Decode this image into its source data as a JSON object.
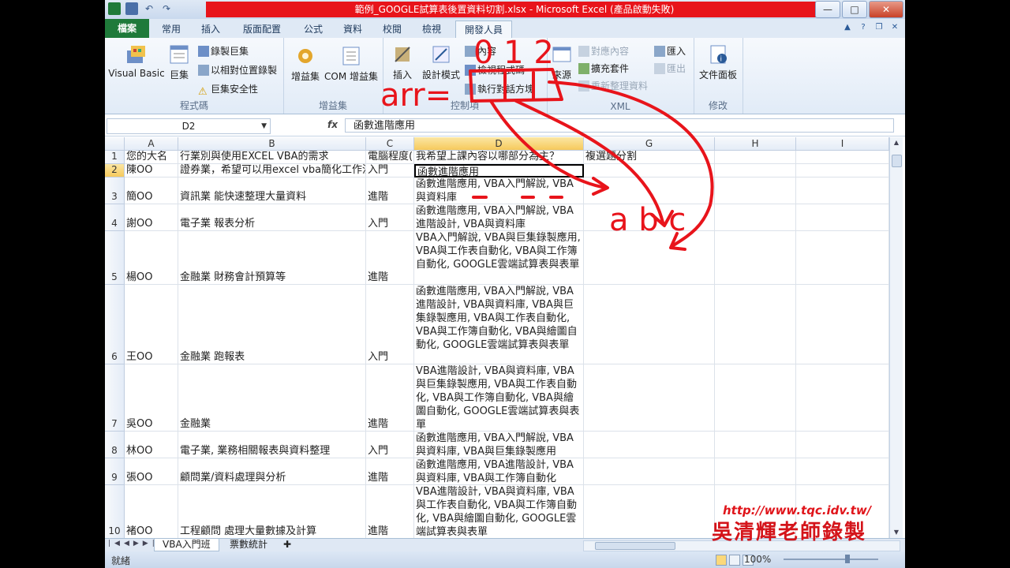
{
  "window": {
    "title": "範例_GOOGLE試算表後置資料切割.xlsx  -  Microsoft Excel (產品啟動失敗)",
    "controls": [
      "—",
      "□",
      "✕"
    ]
  },
  "tabs": [
    "檔案",
    "常用",
    "插入",
    "版面配置",
    "公式",
    "資料",
    "校閱",
    "檢視",
    "開發人員"
  ],
  "ribbon": {
    "code": {
      "label": "程式碼",
      "visual_basic": "Visual Basic",
      "macros": "巨集",
      "record_macro": "錄製巨集",
      "relative_ref": "以相對位置錄製",
      "macro_security": "巨集安全性"
    },
    "addins": {
      "label": "增益集",
      "addins": "增益集",
      "com_addins": "COM 增益集"
    },
    "controls": {
      "label": "控制項",
      "insert": "插入",
      "design_mode": "設計模式",
      "properties": "內容",
      "view_code": "檢視程式碼",
      "run_dialog": "執行對話方塊"
    },
    "xml": {
      "label": "XML",
      "source": "來源",
      "map_properties": "對應內容",
      "expansion_packs": "擴充套件",
      "refresh_data": "重新整理資料",
      "import": "匯入",
      "export": "匯出"
    },
    "modify": {
      "label": "修改",
      "document_panel": "文件面板"
    }
  },
  "formula_bar": {
    "name_box": "D2",
    "fx": "fx",
    "content": "函數進階應用"
  },
  "columns": [
    "A",
    "B",
    "C",
    "D",
    "G",
    "H",
    "I"
  ],
  "rows": [
    {
      "n": "1",
      "a": "您的大名",
      "b": "行業別與使用EXCEL VBA的需求",
      "c": "電腦程度(",
      "d": "我希望上課內容以哪部分為主？",
      "g": "複選題分割"
    },
    {
      "n": "2",
      "a": "陳OO",
      "b": "證券業，希望可以用excel vba簡化工作流程",
      "c": "入門",
      "d": "函數進階應用",
      "g": ""
    },
    {
      "n": "3",
      "a": "簡OO",
      "b": "資訊業  能快速整理大量資料",
      "c": "進階",
      "d": "函數進階應用, VBA入門解說, VBA與資料庫",
      "g": ""
    },
    {
      "n": "4",
      "a": "謝OO",
      "b": "電子業 報表分析",
      "c": "入門",
      "d": "函數進階應用, VBA入門解說, VBA進階設計, VBA與資料庫",
      "g": ""
    },
    {
      "n": "5",
      "a": "楊OO",
      "b": "金融業 財務會計預算等",
      "c": "進階",
      "d": "VBA入門解說, VBA與巨集錄製應用, VBA與工作表自動化, VBA與工作簿自動化, GOOGLE雲端試算表與表單",
      "g": ""
    },
    {
      "n": "6",
      "a": "王OO",
      "b": "金融業 跑報表",
      "c": "入門",
      "d": "函數進階應用, VBA入門解說, VBA進階設計, VBA與資料庫, VBA與巨集錄製應用, VBA與工作表自動化, VBA與工作簿自動化, VBA與繪圖自動化, GOOGLE雲端試算表與表單",
      "g": ""
    },
    {
      "n": "7",
      "a": "吳OO",
      "b": "金融業",
      "c": "進階",
      "d": "VBA進階設計, VBA與資料庫, VBA與巨集錄製應用, VBA與工作表自動化, VBA與工作簿自動化, VBA與繪圖自動化, GOOGLE雲端試算表與表單",
      "g": ""
    },
    {
      "n": "8",
      "a": "林OO",
      "b": "電子業, 業務相關報表與資料整理",
      "c": "入門",
      "d": "函數進階應用, VBA入門解說, VBA與資料庫, VBA與巨集錄製應用",
      "g": ""
    },
    {
      "n": "9",
      "a": "張OO",
      "b": "顧問業/資料處理與分析",
      "c": "進階",
      "d": "函數進階應用, VBA進階設計, VBA與資料庫, VBA與工作簿自動化",
      "g": ""
    },
    {
      "n": "10",
      "a": "褚OO",
      "b": "工程顧問 處理大量數據及計算",
      "c": "進階",
      "d": "VBA進階設計, VBA與資料庫, VBA與工作表自動化, VBA與工作簿自動化, VBA與繪圖自動化, GOOGLE雲端試算表與表單",
      "g": ""
    }
  ],
  "sheets": [
    "VBA入門班",
    "票數統計"
  ],
  "status": {
    "ready": "就緒",
    "zoom": "100%"
  },
  "annotations": {
    "handwriting_top": "0 1 2",
    "handwriting_array": "arr=",
    "handwriting_side": "a b c"
  },
  "watermark": {
    "url": "http://www.tqc.idv.tw/",
    "signature": "吳清輝老師錄製"
  }
}
